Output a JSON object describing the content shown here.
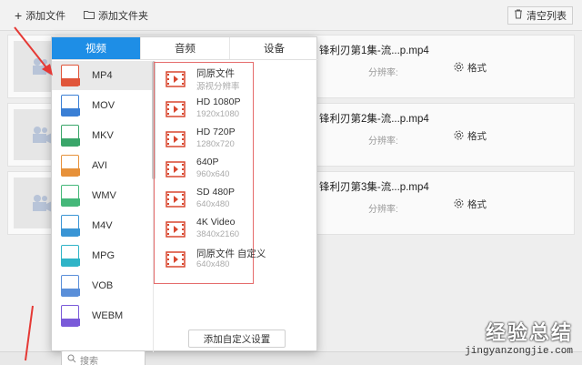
{
  "toolbar": {
    "add_file": "添加文件",
    "add_folder": "添加文件夹",
    "clear_list": "清空列表"
  },
  "files": [
    {
      "name": "锋利刃第1集-流...p.mp4",
      "res_label": "分辨率:",
      "format_label": "格式"
    },
    {
      "name": "锋利刃第2集-流...p.mp4",
      "res_label": "分辨率:",
      "format_label": "格式"
    },
    {
      "name": "锋利刃第3集-流...p.mp4",
      "res_label": "分辨率:",
      "format_label": "格式"
    }
  ],
  "panel": {
    "tabs": [
      "视频",
      "音频",
      "设备"
    ],
    "active_tab": "视频",
    "formats": [
      {
        "label": "MP4",
        "color": "#e0553a"
      },
      {
        "label": "MOV",
        "color": "#3a7fd5"
      },
      {
        "label": "MKV",
        "color": "#3aa66a"
      },
      {
        "label": "AVI",
        "color": "#e7913a"
      },
      {
        "label": "WMV",
        "color": "#45b87a"
      },
      {
        "label": "M4V",
        "color": "#3a95d5"
      },
      {
        "label": "MPG",
        "color": "#2fb4c7"
      },
      {
        "label": "VOB",
        "color": "#5a8fd9"
      },
      {
        "label": "WEBM",
        "color": "#7a5ad9"
      }
    ],
    "selected_format": "MP4",
    "presets": [
      {
        "title": "同原文件",
        "sub": "源视分辨率"
      },
      {
        "title": "HD 1080P",
        "sub": "1920x1080"
      },
      {
        "title": "HD 720P",
        "sub": "1280x720"
      },
      {
        "title": "640P",
        "sub": "960x640"
      },
      {
        "title": "SD 480P",
        "sub": "640x480"
      },
      {
        "title": "4K Video",
        "sub": "3840x2160"
      },
      {
        "title": "同原文件 自定义",
        "sub": "640x480"
      }
    ],
    "search_placeholder": "搜索",
    "custom_button": "添加自定义设置"
  },
  "colors": {
    "accent": "#1e8ee6",
    "highlight_box": "#e56c6c",
    "arrow": "#e53935"
  },
  "watermark": {
    "text": "经验总结",
    "url": "jingyanzongjie.com"
  }
}
